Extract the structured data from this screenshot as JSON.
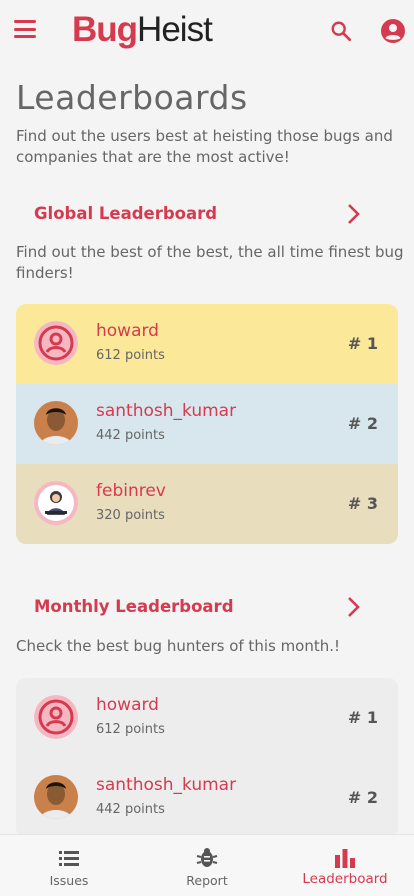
{
  "app": {
    "logo_bug": "Bug",
    "logo_heist": "Heist"
  },
  "page": {
    "title": "Leaderboards",
    "subtitle": "Find out the users best at heisting those bugs and companies that are the most active!"
  },
  "global": {
    "title": "Global Leaderboard",
    "description": "Find out the best of the best, the all time finest bug finders!",
    "rows": [
      {
        "name": "howard",
        "points": "612 points",
        "rank": "# 1",
        "avatar": "default-avatar",
        "bg": "#fbe898"
      },
      {
        "name": "santhosh_kumar",
        "points": "442 points",
        "rank": "# 2",
        "avatar": "photo-avatar",
        "bg": "#d8e7ee"
      },
      {
        "name": "febinrev",
        "points": "320 points",
        "rank": "# 3",
        "avatar": "illustration-avatar",
        "bg": "#e8ddbd"
      }
    ]
  },
  "monthly": {
    "title": "Monthly Leaderboard",
    "description": "Check the best bug hunters of this month.!",
    "rows": [
      {
        "name": "howard",
        "points": "612 points",
        "rank": "# 1",
        "avatar": "default-avatar",
        "bg": "#ededed"
      },
      {
        "name": "santhosh_kumar",
        "points": "442 points",
        "rank": "# 2",
        "avatar": "photo-avatar",
        "bg": "#ededed"
      }
    ]
  },
  "bottom_nav": {
    "items": [
      {
        "label": "Issues",
        "icon": "list-icon",
        "active": false
      },
      {
        "label": "Report",
        "icon": "bug-icon",
        "active": false
      },
      {
        "label": "Leaderboard",
        "icon": "bar-chart-icon",
        "active": true
      }
    ]
  },
  "colors": {
    "accent": "#d63a4f",
    "gold": "#fbe898",
    "silver": "#d8e7ee",
    "bronze": "#e8ddbd",
    "background": "#f4f4f4"
  }
}
